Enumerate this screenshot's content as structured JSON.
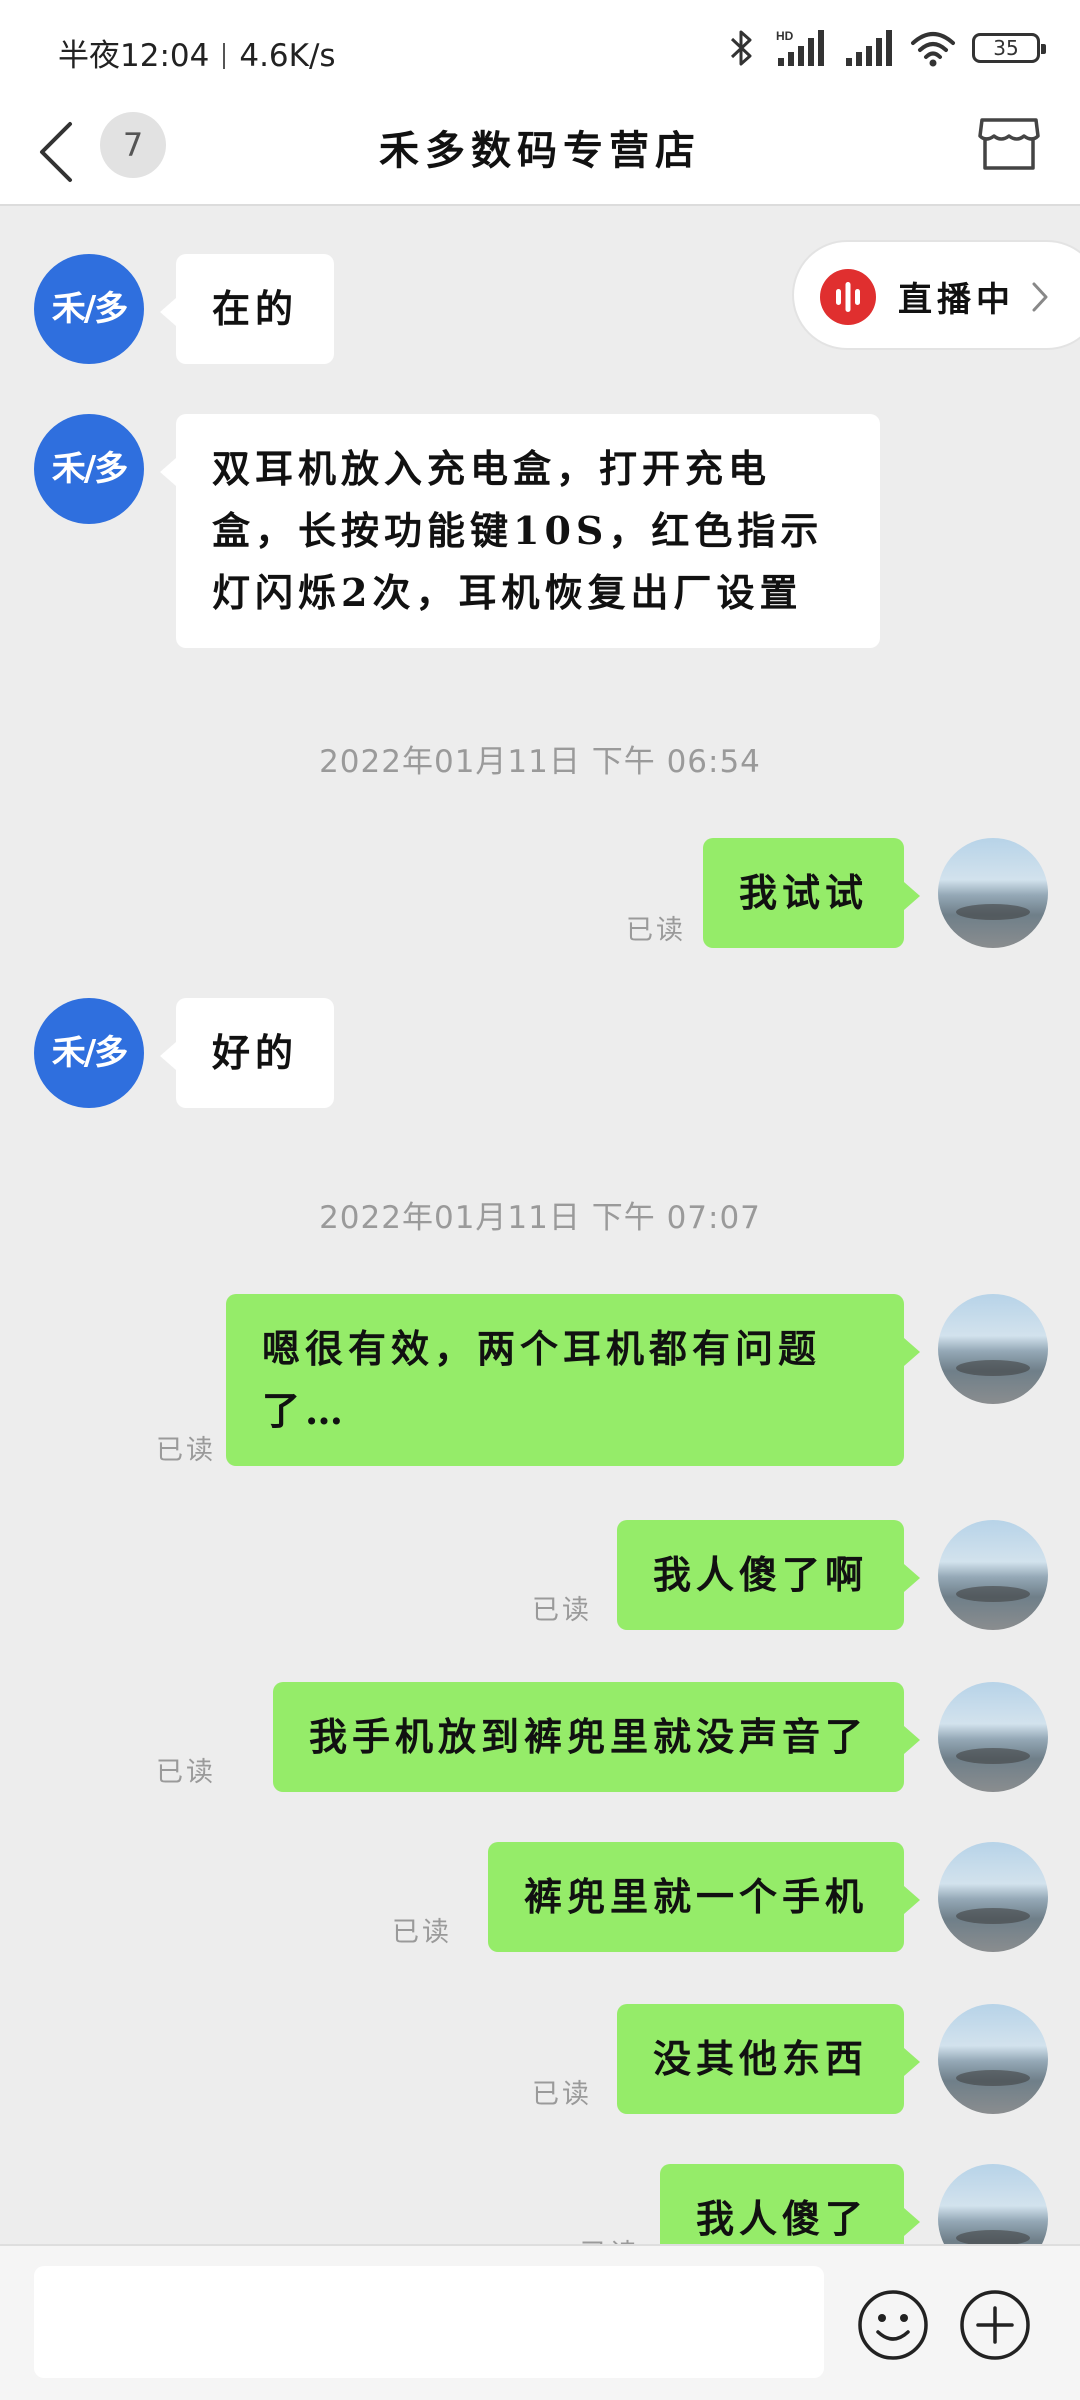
{
  "status_bar": {
    "time": "半夜12:04",
    "speed": "4.6K/s",
    "hd_label": "HD",
    "battery": "35",
    "icons": [
      "bluetooth-icon",
      "signal-hd-icon",
      "signal-icon",
      "wifi-icon",
      "battery-icon"
    ]
  },
  "header": {
    "back_icon": "chevron-left-icon",
    "unread_count": "7",
    "title": "禾多数码专营店",
    "store_icon": "store-icon"
  },
  "live": {
    "label": "直播中",
    "icon": "sound-wave-icon"
  },
  "shop_avatar_text": "禾/多",
  "read_label": "已读",
  "messages": [
    {
      "side": "left",
      "text": "在的"
    },
    {
      "side": "left",
      "text": "双耳机放入充电盒，打开充电盒，长按功能键10S，红色指示灯闪烁2次，耳机恢复出厂设置"
    },
    {
      "type": "time",
      "text": "2022年01月11日  下午  06:54"
    },
    {
      "side": "right",
      "text": "我试试",
      "read": "已读"
    },
    {
      "side": "left",
      "text": "好的"
    },
    {
      "type": "time",
      "text": "2022年01月11日  下午  07:07"
    },
    {
      "side": "right",
      "text": "嗯很有效，两个耳机都有问题了…",
      "read": "已读"
    },
    {
      "side": "right",
      "text": "我人傻了啊",
      "read": "已读"
    },
    {
      "side": "right",
      "text": "我手机放到裤兜里就没声音了",
      "read": "已读"
    },
    {
      "side": "right",
      "text": "裤兜里就一个手机",
      "read": "已读"
    },
    {
      "side": "right",
      "text": "没其他东西",
      "read": "已读"
    },
    {
      "side": "right",
      "text": "我人傻了",
      "read": "已读"
    }
  ],
  "input": {
    "placeholder": "",
    "emoji_icon": "emoji-icon",
    "plus_icon": "plus-icon"
  },
  "colors": {
    "sent_bubble": "#95ec69",
    "received_bubble": "#ffffff",
    "shop_avatar": "#2f6fde",
    "live_dot": "#e02f2f",
    "background": "#ededed"
  }
}
